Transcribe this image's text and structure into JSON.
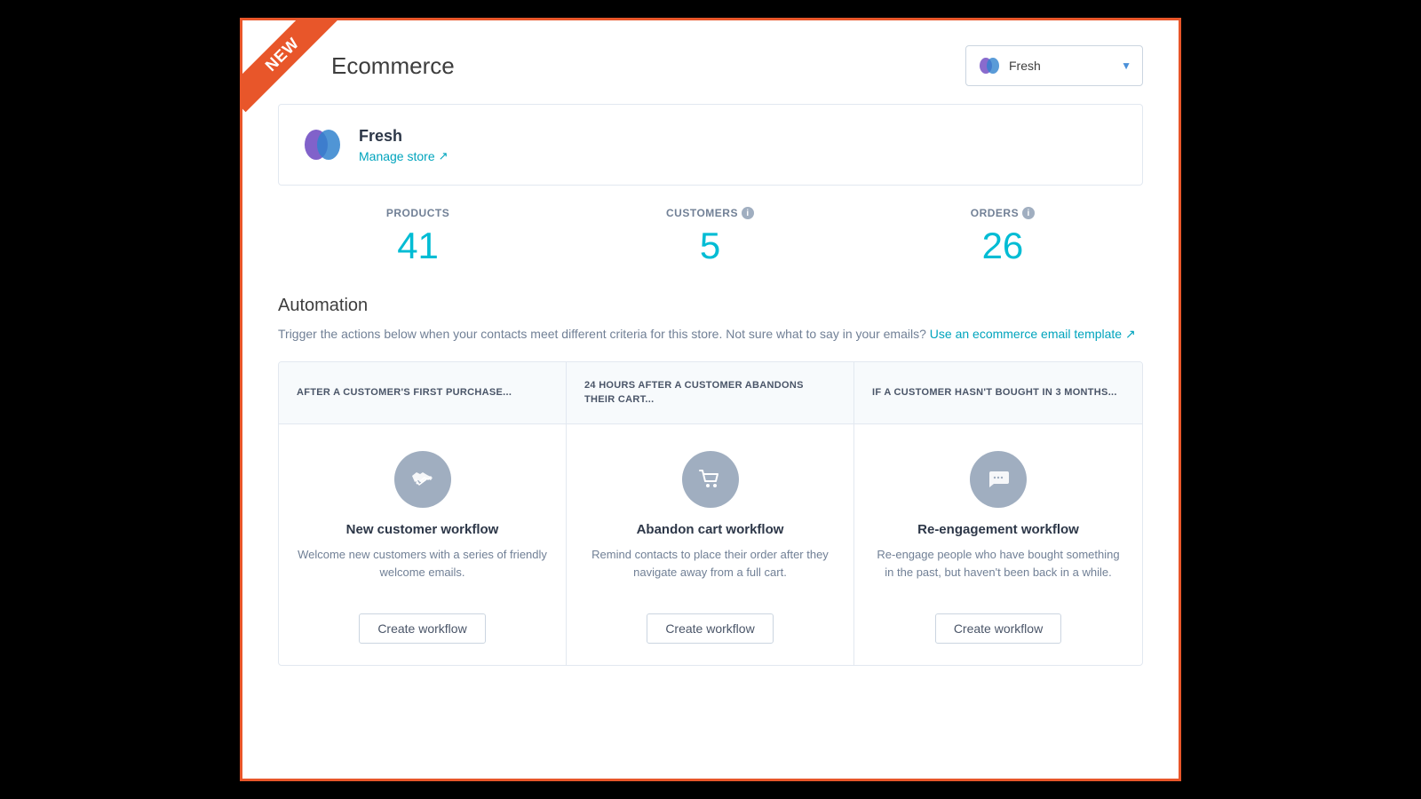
{
  "ribbon": {
    "text": "NEW"
  },
  "header": {
    "title": "Ecommerce",
    "selector": {
      "store_name": "Fresh",
      "dropdown_arrow": "▼"
    }
  },
  "store_card": {
    "name": "Fresh",
    "manage_store_label": "Manage store",
    "external_icon": "↗"
  },
  "stats": {
    "products": {
      "label": "PRODUCTS",
      "value": "41"
    },
    "customers": {
      "label": "CUSTOMERS",
      "value": "5",
      "has_info": true
    },
    "orders": {
      "label": "ORDERS",
      "value": "26",
      "has_info": true
    }
  },
  "automation": {
    "title": "Automation",
    "description": "Trigger the actions below when your contacts meet different criteria for this store. Not sure what to say in your emails?",
    "email_template_link": "Use an ecommerce email template",
    "external_icon": "↗"
  },
  "workflows": [
    {
      "trigger": "AFTER A CUSTOMER'S FIRST PURCHASE...",
      "icon": "🤝",
      "name": "New customer workflow",
      "description": "Welcome new customers with a series of friendly welcome emails.",
      "button_label": "Create workflow",
      "icon_type": "handshake"
    },
    {
      "trigger": "24 HOURS AFTER A CUSTOMER ABANDONS THEIR CART...",
      "icon": "🛒",
      "name": "Abandon cart workflow",
      "description": "Remind contacts to place their order after they navigate away from a full cart.",
      "button_label": "Create workflow",
      "icon_type": "cart"
    },
    {
      "trigger": "IF A CUSTOMER HASN'T BOUGHT IN 3 MONTHS...",
      "icon": "💬",
      "name": "Re-engagement workflow",
      "description": "Re-engage people who have bought something in the past, but haven't been back in a while.",
      "button_label": "Create workflow",
      "icon_type": "chat"
    }
  ]
}
